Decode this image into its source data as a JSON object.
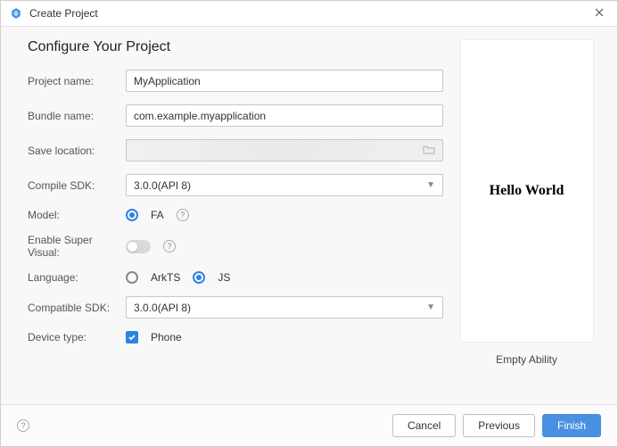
{
  "titlebar": {
    "title": "Create Project"
  },
  "heading": "Configure Your Project",
  "form": {
    "project_name": {
      "label": "Project name:",
      "value": "MyApplication"
    },
    "bundle_name": {
      "label": "Bundle name:",
      "value": "com.example.myapplication"
    },
    "save_location": {
      "label": "Save location:"
    },
    "compile_sdk": {
      "label": "Compile SDK:",
      "value": "3.0.0(API 8)"
    },
    "model": {
      "label": "Model:",
      "options": {
        "fa": "FA"
      },
      "selected": "fa"
    },
    "enable_super_visual": {
      "label": "Enable Super Visual:",
      "value": false
    },
    "language": {
      "label": "Language:",
      "options": {
        "arkts": "ArkTS",
        "js": "JS"
      },
      "selected": "js"
    },
    "compatible_sdk": {
      "label": "Compatible SDK:",
      "value": "3.0.0(API 8)"
    },
    "device_type": {
      "label": "Device type:",
      "phone_label": "Phone",
      "phone_checked": true
    }
  },
  "preview": {
    "content": "Hello World",
    "caption": "Empty Ability"
  },
  "footer": {
    "cancel": "Cancel",
    "previous": "Previous",
    "finish": "Finish"
  }
}
